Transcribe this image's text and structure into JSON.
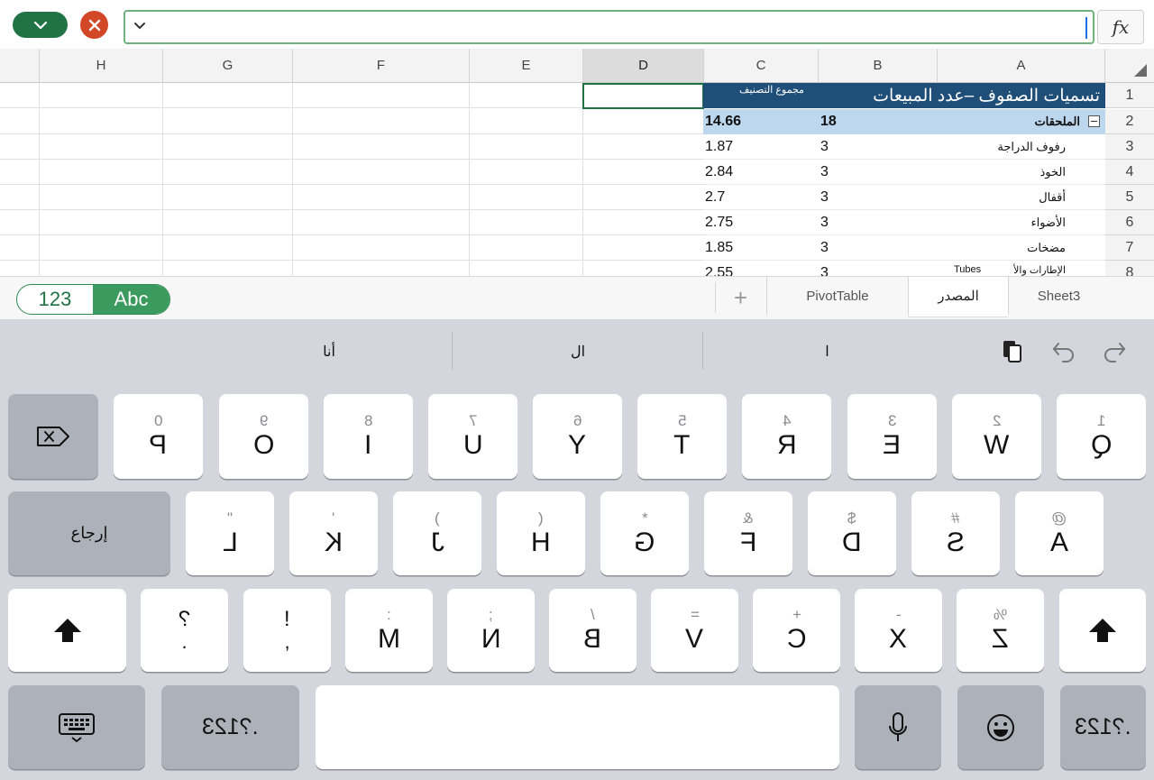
{
  "formula_bar": {
    "confirm_icon": "chevron-down-icon",
    "cancel_icon": "close-icon",
    "value": "",
    "fx_label": "fx"
  },
  "grid": {
    "columns": [
      "H",
      "G",
      "F",
      "E",
      "D",
      "C",
      "B",
      "A"
    ],
    "active_column": "D",
    "rows": [
      "1",
      "2",
      "3",
      "4",
      "5",
      "6",
      "7",
      "8"
    ]
  },
  "pivot": {
    "header_main": "تسميات الصفوف –عدد المبيعات",
    "header_sum": "مجموع التصنيف",
    "total": {
      "label": "الملحقات",
      "count": "18",
      "sum": "14.66"
    },
    "items": [
      {
        "label": "رفوف الدراجة",
        "count": "3",
        "sum": "1.87"
      },
      {
        "label": "الخوذ",
        "count": "3",
        "sum": "2.84"
      },
      {
        "label": "أقفال",
        "count": "3",
        "sum": "2.7"
      },
      {
        "label": "الأضواء",
        "count": "3",
        "sum": "2.75"
      },
      {
        "label": "مضخات",
        "count": "3",
        "sum": "1.85"
      },
      {
        "label": "الإطارات والأ",
        "count": "3",
        "sum": "2.55",
        "clip": "Tubes"
      }
    ]
  },
  "tabs_bar": {
    "mode_numeric": "123",
    "mode_text": "Abc",
    "add_label": "+",
    "sheets": [
      "PivotTable",
      "المصدر",
      "Sheet3"
    ],
    "active_sheet": "المصدر"
  },
  "keyboard": {
    "suggestions": [
      "أنا",
      "ال",
      "ا"
    ],
    "row1": [
      {
        "pri": "P",
        "sec": "0"
      },
      {
        "pri": "O",
        "sec": "9"
      },
      {
        "pri": "I",
        "sec": "8"
      },
      {
        "pri": "U",
        "sec": "7"
      },
      {
        "pri": "Y",
        "sec": "6"
      },
      {
        "pri": "T",
        "sec": "5"
      },
      {
        "pri": "R",
        "sec": "4"
      },
      {
        "pri": "E",
        "sec": "3"
      },
      {
        "pri": "W",
        "sec": "2"
      },
      {
        "pri": "Q",
        "sec": "1"
      }
    ],
    "row2": [
      {
        "pri": "L",
        "sec": "\""
      },
      {
        "pri": "K",
        "sec": "'"
      },
      {
        "pri": "J",
        "sec": ")"
      },
      {
        "pri": "H",
        "sec": "("
      },
      {
        "pri": "G",
        "sec": "*"
      },
      {
        "pri": "F",
        "sec": "&"
      },
      {
        "pri": "D",
        "sec": "$"
      },
      {
        "pri": "S",
        "sec": "#"
      },
      {
        "pri": "A",
        "sec": "@"
      }
    ],
    "row3": [
      {
        "pri": "?",
        "sec": "."
      },
      {
        "pri": "!",
        "sec": ","
      },
      {
        "pri": "M",
        "sec": ":"
      },
      {
        "pri": "N",
        "sec": ";"
      },
      {
        "pri": "B",
        "sec": "/"
      },
      {
        "pri": "V",
        "sec": "="
      },
      {
        "pri": "C",
        "sec": "+"
      },
      {
        "pri": "X",
        "sec": "-"
      },
      {
        "pri": "Z",
        "sec": "%"
      }
    ],
    "return_label": "إرجاع",
    "numbers_label": ".?123",
    "space_label": ""
  }
}
